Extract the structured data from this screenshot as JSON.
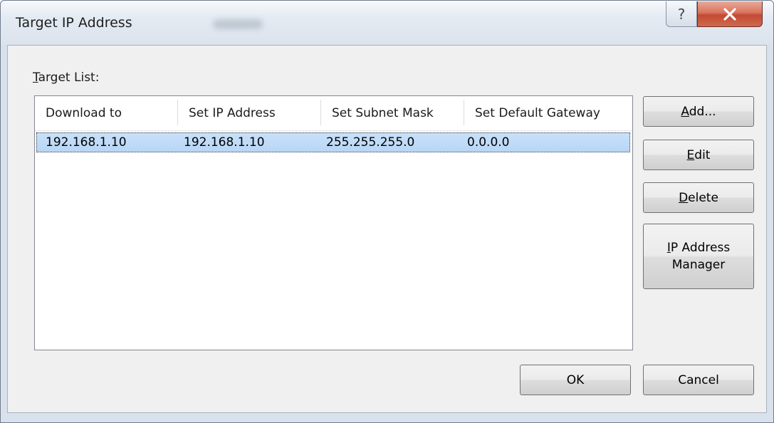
{
  "window": {
    "title": "Target IP Address"
  },
  "titlebar_buttons": {
    "help_glyph": "?",
    "close_icon": "close-icon"
  },
  "target_list": {
    "label_accel": "T",
    "label_rest": "arget List:",
    "columns": [
      "Download to",
      "Set IP Address",
      "Set Subnet Mask",
      "Set Default Gateway"
    ],
    "rows": [
      [
        "192.168.1.10",
        "192.168.1.10",
        "255.255.255.0",
        "0.0.0.0"
      ]
    ],
    "selected_row": 0
  },
  "side_buttons": {
    "add_accel": "A",
    "add_rest": "dd...",
    "edit_accel": "E",
    "edit_rest": "dit",
    "delete_accel": "D",
    "delete_rest": "elete",
    "ipmgr_accel": "I",
    "ipmgr_line1_rest": "P Address",
    "ipmgr_line2": "Manager"
  },
  "footer_buttons": {
    "ok": "OK",
    "cancel": "Cancel"
  },
  "colors": {
    "selection": "#b7d6f6",
    "close_button": "#c34a33",
    "client_bg": "#f0f0f0"
  }
}
